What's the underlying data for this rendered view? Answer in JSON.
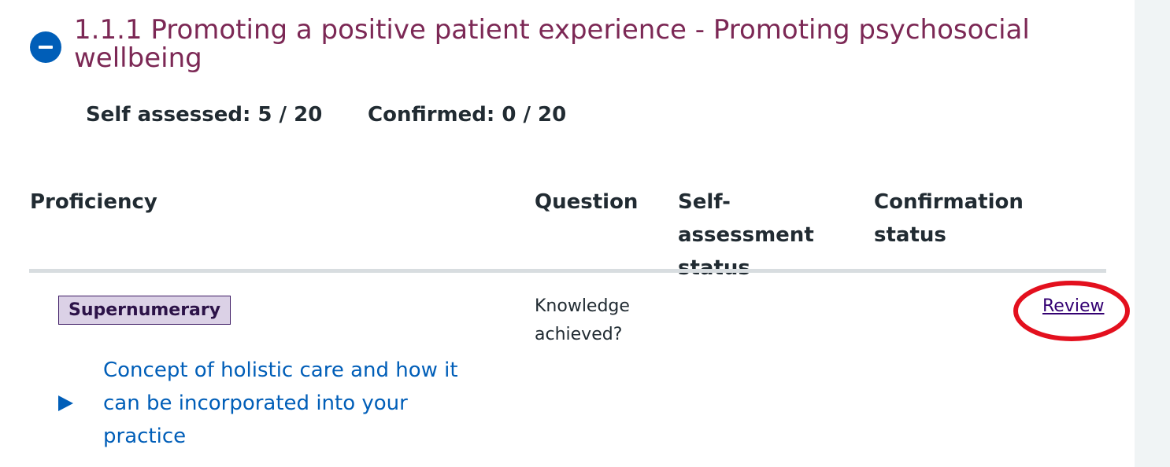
{
  "section": {
    "title": "1.1.1 Promoting a positive patient experience - Promoting psychosocial wellbeing",
    "toggle_icon": "minus-circle-icon"
  },
  "summary": {
    "self_assessed": "Self assessed: 5 / 20",
    "confirmed": "Confirmed: 0 / 20"
  },
  "table": {
    "headers": {
      "proficiency": "Proficiency",
      "question": "Question",
      "self_assessment_status": "Self-assessment status",
      "confirmation_status": "Confirmation status"
    },
    "rows": [
      {
        "tag": "Supernumerary",
        "proficiency_detail": "Concept of holistic care and how it can be incorporated into your practice",
        "question": "Knowledge achieved?",
        "self_assessment_status": "",
        "confirmation_status": "",
        "action": "Review"
      }
    ]
  },
  "colors": {
    "title": "#7c2855",
    "link": "#005eb8",
    "visited_link": "#330072",
    "tag_bg": "#dbd1e6",
    "highlight": "#e3101e",
    "gutter": "#f0f4f5"
  }
}
